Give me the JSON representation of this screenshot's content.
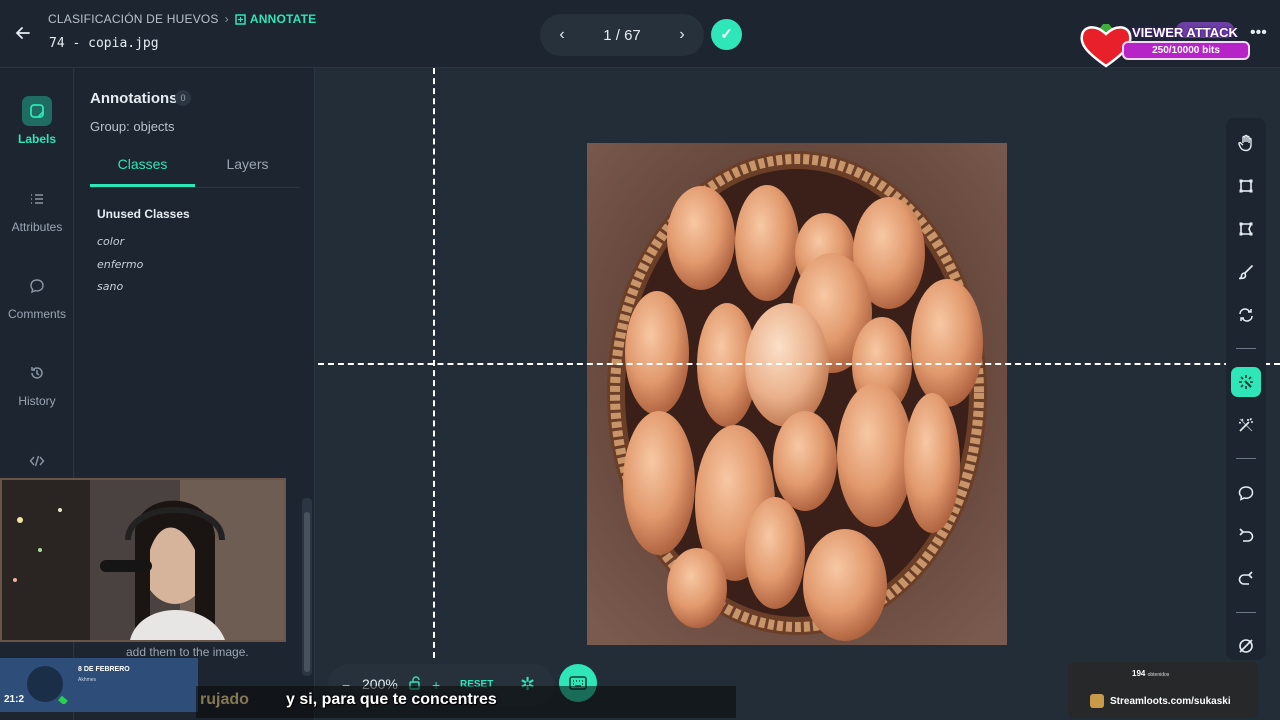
{
  "header": {
    "project": "CLASIFICACIÓN DE HUEVOS",
    "section": "ANNOTATE",
    "filename": "74 - copia.jpg",
    "pager": "1 / 67"
  },
  "viewer_attack": {
    "title": "VIEWER ATTACK",
    "bits": "250/10000 bits"
  },
  "rail": {
    "items": [
      {
        "label": "Labels"
      },
      {
        "label": "Attributes"
      },
      {
        "label": "Comments"
      },
      {
        "label": "History"
      }
    ]
  },
  "panel": {
    "title": "Annotations",
    "count": "0",
    "group": "Group: objects",
    "tabs": [
      {
        "label": "Classes"
      },
      {
        "label": "Layers"
      }
    ],
    "unused_heading": "Unused Classes",
    "classes": [
      "color",
      "enfermo",
      "sano"
    ],
    "hint": "add them to the image."
  },
  "zoom": {
    "value": "200%",
    "reset": "RESET"
  },
  "stream": {
    "clock": "21:2",
    "date_title": "8 DE FEBRERO",
    "date_sub": "Akhmes",
    "subtitle_prev": "rujado",
    "subtitle": "y si, para que te concentres",
    "loots_count": "194",
    "loots_label": "obtenidos",
    "loots_url": "Streamloots.com/sukaski"
  },
  "colors": {
    "accent": "#2ee6b8",
    "background": "#1f2933",
    "panel": "#1c2530"
  },
  "icons": {
    "tools": [
      "hand-icon",
      "bounding-box-icon",
      "polygon-icon",
      "brush-icon",
      "convert-icon",
      "smart-select-icon",
      "magic-wand-icon",
      "comment-icon",
      "undo-icon",
      "redo-icon",
      "clear-icon"
    ]
  }
}
